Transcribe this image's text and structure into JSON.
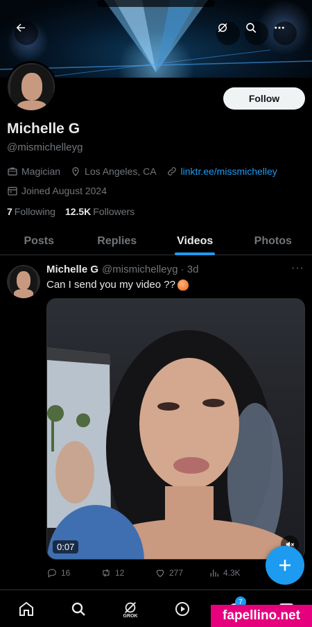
{
  "profile": {
    "name": "Michelle G",
    "handle": "@mismichelleyg",
    "category": "Magician",
    "location": "Los Angeles, CA",
    "link": "linktr.ee/missmichelley",
    "joined": "Joined August 2024",
    "following_count": "7",
    "following_label": "Following",
    "followers_count": "12.5K",
    "followers_label": "Followers",
    "follow_button": "Follow"
  },
  "tabs": [
    {
      "label": "Posts"
    },
    {
      "label": "Replies"
    },
    {
      "label": "Videos"
    },
    {
      "label": "Photos"
    }
  ],
  "active_tab": "Videos",
  "post": {
    "author": "Michelle G",
    "meta": "@mismichelleyg · 3d",
    "text": "Can I send you my video ??",
    "video_duration": "0:07",
    "replies": "16",
    "reposts": "12",
    "likes": "277",
    "views": "4.3K"
  },
  "bottom_nav": {
    "grok_label": "GROK",
    "notifications_badge": "7"
  },
  "watermark": "fapellino.net",
  "colors": {
    "accent": "#1d9bf0",
    "background": "#000000",
    "muted_text": "#71767b",
    "watermark_bg": "#e6007e"
  }
}
